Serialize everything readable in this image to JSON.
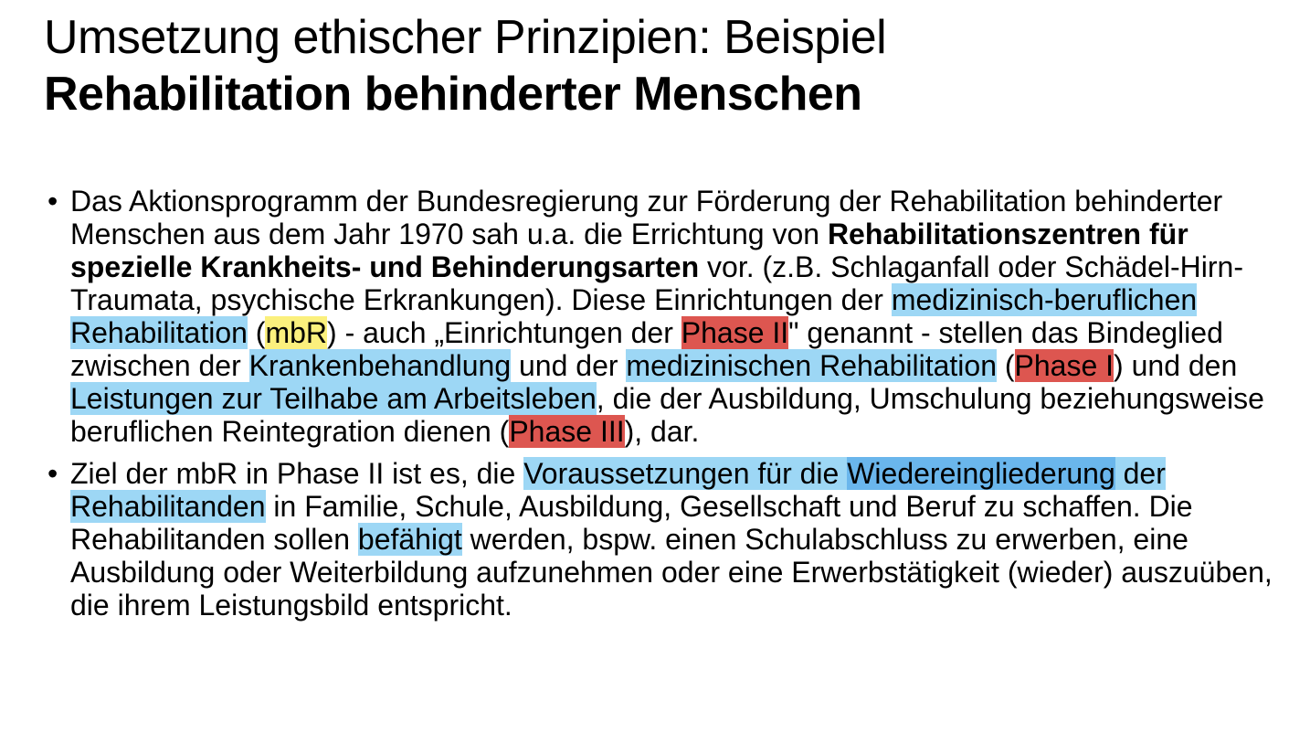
{
  "title": {
    "line1": "Umsetzung ethischer Prinzipien: Beispiel",
    "line2": "Rehabilitation behinderter Menschen"
  },
  "bullet_symbol": "•",
  "bullet1": {
    "t1": "Das Aktionsprogramm der Bundesregierung zur Förderung der Rehabilitation behinderter Menschen aus dem Jahr 1970 sah u.a. die Errichtung von ",
    "b1": "Rehabilitationszentren für spezielle Krankheits- und Behinderungsarten",
    "t2": " vor. (z.B. Schlaganfall oder Schädel-Hirn-Traumata, psychische Erkrankungen). Diese Einrichtungen der ",
    "h1": "medizinisch-beruflichen Rehabilitation",
    "t3": " (",
    "h2": "mbR",
    "t4": ") - auch „Einrichtungen der ",
    "h3": "Phase II",
    "t5": "\" genannt - stellen das Bindeglied zwischen der ",
    "h4": "Krankenbehandlung",
    "t6": " und der ",
    "h5": "medizinischen Rehabilitation",
    "t7": " (",
    "h6": "Phase I",
    "t8": ") und den ",
    "h7": "Leistungen zur Teilhabe am Arbeitsleben",
    "t9": ", die der Ausbildung, Umschulung beziehungsweise beruflichen Reintegration dienen (",
    "h8": "Phase III",
    "t10": "), dar."
  },
  "bullet2": {
    "t1": "Ziel der mbR in Phase II ist es, die ",
    "h1": "Voraussetzungen für die ",
    "h2": "Wiedereingliederung",
    "h3": " der Rehabilitanden",
    "t2": " in Familie, Schule, Ausbildung, Gesellschaft und Beruf zu schaffen. Die Rehabilitanden sollen ",
    "h4": "befähigt",
    "t3": " werden, bspw. einen Schulabschluss zu erwerben, eine Ausbildung oder Weiterbildung aufzunehmen oder eine Erwerbstätigkeit (wieder) auszuüben, die ihrem Leistungsbild entspricht."
  },
  "colors": {
    "highlight_blue": "#9dd7f5",
    "highlight_blue_dark": "#6ab6ec",
    "highlight_red": "#dd5650",
    "highlight_yellow": "#fbf07d"
  }
}
